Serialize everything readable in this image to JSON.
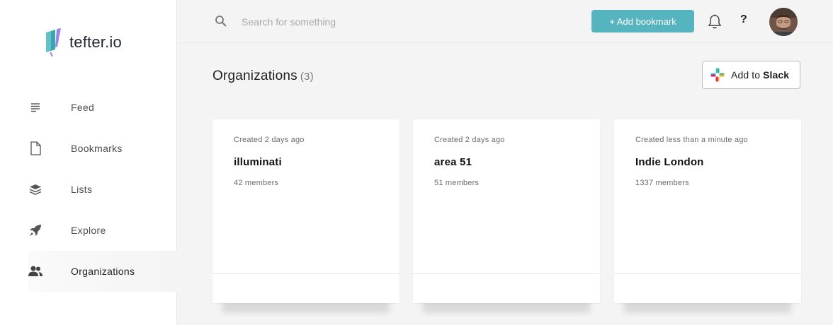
{
  "app": {
    "logo_text": "tefter.io"
  },
  "sidebar": {
    "items": [
      {
        "label": "Feed",
        "icon": "feed-icon"
      },
      {
        "label": "Bookmarks",
        "icon": "document-icon"
      },
      {
        "label": "Lists",
        "icon": "layers-icon"
      },
      {
        "label": "Explore",
        "icon": "rocket-icon"
      },
      {
        "label": "Organizations",
        "icon": "users-icon",
        "active": true
      }
    ]
  },
  "topbar": {
    "search_placeholder": "Search for something",
    "add_bookmark_label": "+ Add bookmark",
    "help_label": "?"
  },
  "page": {
    "title": "Organizations",
    "count": "(3)",
    "slack_prefix": "Add to ",
    "slack_brand": "Slack"
  },
  "organizations": [
    {
      "created": "Created 2 days ago",
      "name": "illuminati",
      "members": "42 members"
    },
    {
      "created": "Created 2 days ago",
      "name": "area 51",
      "members": "51 members"
    },
    {
      "created": "Created less than a minute ago",
      "name": "Indie London",
      "members": "1337 members"
    }
  ],
  "colors": {
    "accent": "#56b4be",
    "logo_teal": "#5fc3c8",
    "logo_purple": "#9b87e6"
  }
}
